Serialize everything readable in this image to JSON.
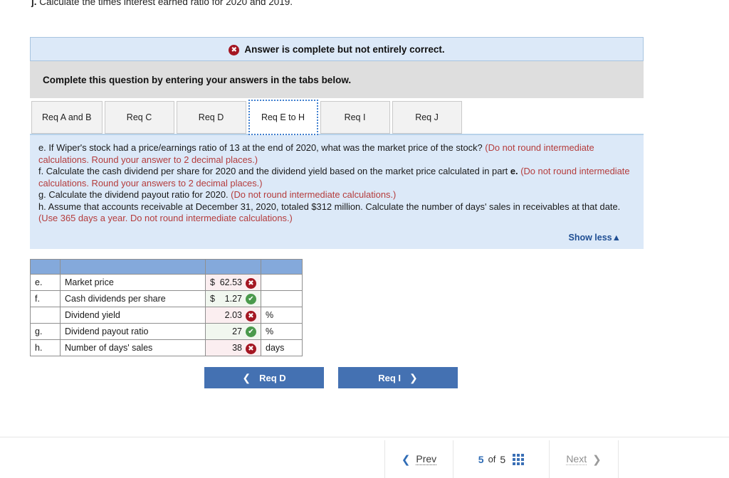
{
  "top_question": {
    "label": "j.",
    "text": "Calculate the times interest earned ratio for 2020 and 2019."
  },
  "alert": {
    "icon": "x-circle-icon",
    "text": "Answer is complete but not entirely correct."
  },
  "instruction": {
    "text": "Complete this question by entering your answers in the tabs below."
  },
  "tabs": [
    {
      "label": "Req A and B",
      "active": false
    },
    {
      "label": "Req C",
      "active": false
    },
    {
      "label": "Req D",
      "active": false
    },
    {
      "label": "Req E to H",
      "active": true
    },
    {
      "label": "Req I",
      "active": false
    },
    {
      "label": "Req J",
      "active": false
    }
  ],
  "question_panel": {
    "e_black_1": "e. If Wiper's stock had a price/earnings ratio of 13 at the end of 2020, what was the market price of the stock? ",
    "e_red": "(Do not round intermediate calculations. Round your answer to 2 decimal places.)",
    "f_black_1": "f. Calculate the cash dividend per share for 2020 and the dividend yield based on the market price calculated in part ",
    "f_bold": "e.",
    "f_red": " (Do not round intermediate calculations. Round your answers to 2 decimal places.)",
    "g_black": "g. Calculate the dividend payout ratio for 2020. ",
    "g_red": "(Do not round intermediate calculations.)",
    "h_black": "h. Assume that accounts receivable at December 31, 2020, totaled $312 million. Calculate the number of days' sales in receivables at that date. ",
    "h_red": "(Use 365 days a year. Do not round intermediate calculations.)",
    "show_less": "Show less",
    "show_less_icon": "caret-up-icon"
  },
  "answer_table": {
    "rows": [
      {
        "label": "e.",
        "desc": "Market price",
        "currency": "$",
        "value": "62.53",
        "unit": "",
        "status": "wrong"
      },
      {
        "label": "f.",
        "desc": "Cash dividends per share",
        "currency": "$",
        "value": "1.27",
        "unit": "",
        "status": "right"
      },
      {
        "label": "",
        "desc": "Dividend yield",
        "currency": "",
        "value": "2.03",
        "unit": "%",
        "status": "wrong"
      },
      {
        "label": "g.",
        "desc": "Dividend payout ratio",
        "currency": "",
        "value": "27",
        "unit": "%",
        "status": "right"
      },
      {
        "label": "h.",
        "desc": "Number of days' sales",
        "currency": "",
        "value": "38",
        "unit": "days",
        "status": "wrong"
      }
    ]
  },
  "req_nav": {
    "prev_label": "Req D",
    "prev_icon": "chevron-left-icon",
    "next_label": "Req I",
    "next_icon": "chevron-right-icon"
  },
  "footer": {
    "prev_label": "Prev",
    "prev_icon": "chevron-left-icon",
    "current_page": "5",
    "of_label": "of",
    "total_pages": "5",
    "grid_icon": "grid-view-icon",
    "next_label": "Next",
    "next_icon": "chevron-right-icon"
  },
  "colors": {
    "accent_blue": "#4471b2",
    "alert_blue_bg": "#dce9f8",
    "instruction_gray": "#dedede",
    "table_header_blue": "#84a9db",
    "wrong_red": "#a41622",
    "right_green": "#4a9a4c",
    "red_text": "#b43c3c"
  }
}
